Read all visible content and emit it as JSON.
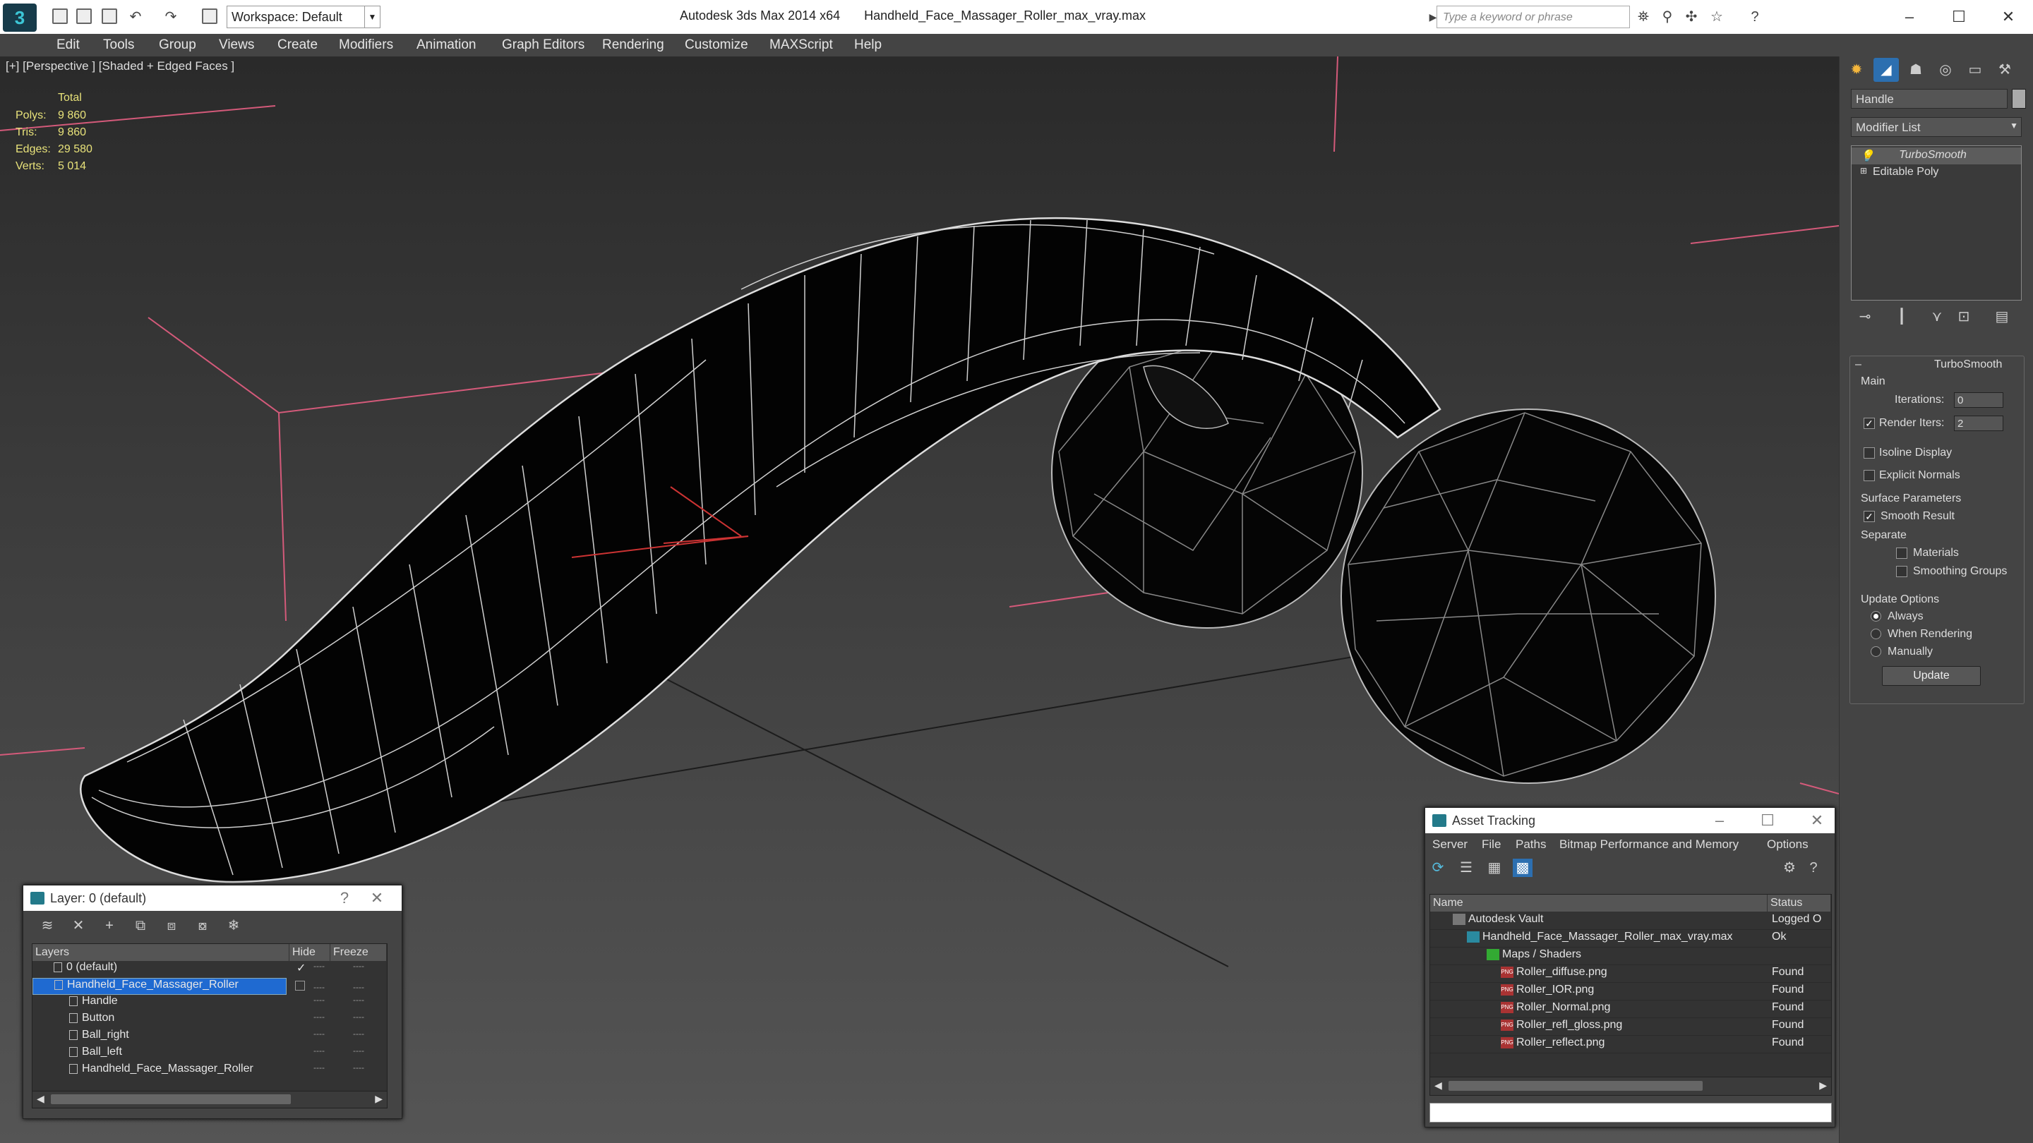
{
  "app": {
    "logo": "3",
    "title": "Autodesk 3ds Max 2014 x64",
    "file": "Handheld_Face_Massager_Roller_max_vray.max",
    "workspace": "Workspace: Default",
    "search_placeholder": "Type a keyword or phrase"
  },
  "menu": [
    "Edit",
    "Tools",
    "Group",
    "Views",
    "Create",
    "Modifiers",
    "Animation",
    "Graph Editors",
    "Rendering",
    "Customize",
    "MAXScript",
    "Help"
  ],
  "viewport": {
    "label": "[+] [Perspective ] [Shaded + Edged Faces ]",
    "stats_header": "Total",
    "stats": [
      {
        "label": "Polys:",
        "value": "9 860"
      },
      {
        "label": "Tris:",
        "value": "9 860"
      },
      {
        "label": "Edges:",
        "value": "29 580"
      },
      {
        "label": "Verts:",
        "value": "5 014"
      }
    ]
  },
  "command_panel": {
    "object_name": "Handle",
    "modifier_list": "Modifier List",
    "stack": [
      "TurboSmooth",
      "Editable Poly"
    ],
    "rollout_title": "TurboSmooth",
    "main_label": "Main",
    "iterations_label": "Iterations:",
    "iterations_value": "0",
    "render_iters_label": "Render Iters:",
    "render_iters_value": "2",
    "isoline": "Isoline Display",
    "explicit_normals": "Explicit Normals",
    "surface_params": "Surface Parameters",
    "smooth_result": "Smooth Result",
    "separate": "Separate",
    "materials": "Materials",
    "smoothing_groups": "Smoothing Groups",
    "update_options": "Update Options",
    "always": "Always",
    "when_rendering": "When Rendering",
    "manually": "Manually",
    "update_button": "Update"
  },
  "layer_window": {
    "title": "Layer: 0 (default)",
    "help": "?",
    "columns": [
      "Layers",
      "Hide",
      "Freeze"
    ],
    "rows": [
      {
        "name": "0 (default)",
        "indent": 0
      },
      {
        "name": "Handheld_Face_Massager_Roller",
        "indent": 0,
        "selected": true
      },
      {
        "name": "Handle",
        "indent": 1
      },
      {
        "name": "Button",
        "indent": 1
      },
      {
        "name": "Ball_right",
        "indent": 1
      },
      {
        "name": "Ball_left",
        "indent": 1
      },
      {
        "name": "Handheld_Face_Massager_Roller",
        "indent": 1
      }
    ],
    "dash": "----"
  },
  "asset_window": {
    "title": "Asset Tracking",
    "menu": [
      "Server",
      "File",
      "Paths",
      "Bitmap Performance and Memory",
      "Options"
    ],
    "columns": [
      "Name",
      "Status"
    ],
    "rows": [
      {
        "name": "Autodesk Vault",
        "status": "Logged O",
        "indent": 0,
        "icon": "vault"
      },
      {
        "name": "Handheld_Face_Massager_Roller_max_vray.max",
        "status": "Ok",
        "indent": 1,
        "icon": "max"
      },
      {
        "name": "Maps / Shaders",
        "status": "",
        "indent": 2,
        "icon": "maps"
      },
      {
        "name": "Roller_diffuse.png",
        "status": "Found",
        "indent": 3,
        "icon": "png"
      },
      {
        "name": "Roller_IOR.png",
        "status": "Found",
        "indent": 3,
        "icon": "png"
      },
      {
        "name": "Roller_Normal.png",
        "status": "Found",
        "indent": 3,
        "icon": "png"
      },
      {
        "name": "Roller_refl_gloss.png",
        "status": "Found",
        "indent": 3,
        "icon": "png"
      },
      {
        "name": "Roller_reflect.png",
        "status": "Found",
        "indent": 3,
        "icon": "png"
      }
    ],
    "png_icon_text": "PNG"
  }
}
